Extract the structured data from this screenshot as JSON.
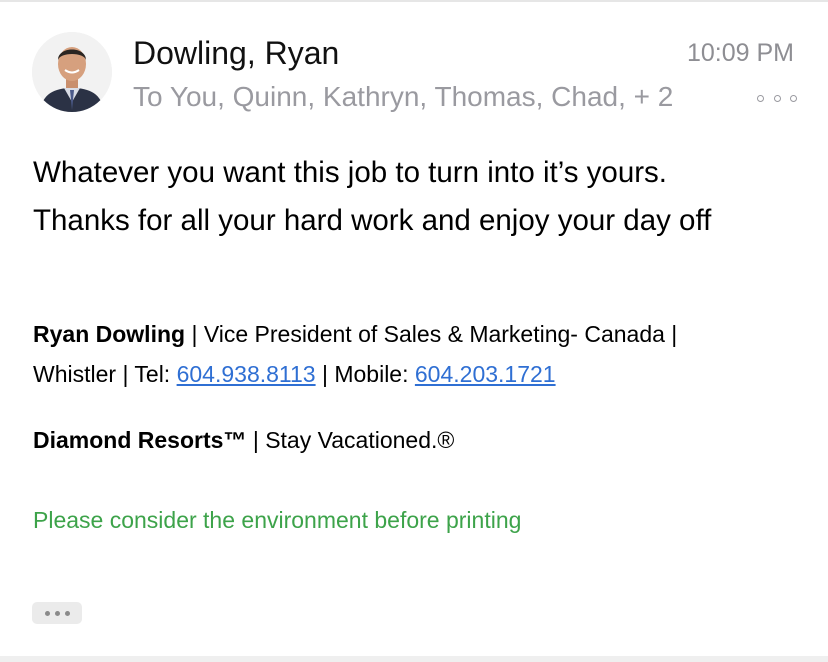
{
  "email": {
    "sender": "Dowling, Ryan",
    "time": "10:09 PM",
    "recipients": "To You, Quinn, Kathryn, Thomas, Chad, + 2",
    "body_lines": [
      "Whatever you want this job to turn into it’s yours.",
      "Thanks for all your hard work and enjoy your day off"
    ]
  },
  "signature": {
    "name": "Ryan Dowling",
    "title_part": " | Vice President of Sales & Marketing- Canada |",
    "location_tel_label": "Whistler | Tel: ",
    "tel": "604.938.8113",
    "mobile_label": " | Mobile: ",
    "mobile": "604.203.1721",
    "company": "Diamond Resorts™",
    "tagline": " | Stay Vacationed.®",
    "environment_note": "Please consider the environment before printing"
  },
  "icons": {
    "more_options": "ellipsis-circles-icon",
    "show_trimmed": "ellipsis-icon",
    "avatar": "sender-avatar"
  },
  "colors": {
    "link": "#2f6fd3",
    "environment_note": "#3da34a",
    "secondary_text": "#9a9aa0"
  }
}
